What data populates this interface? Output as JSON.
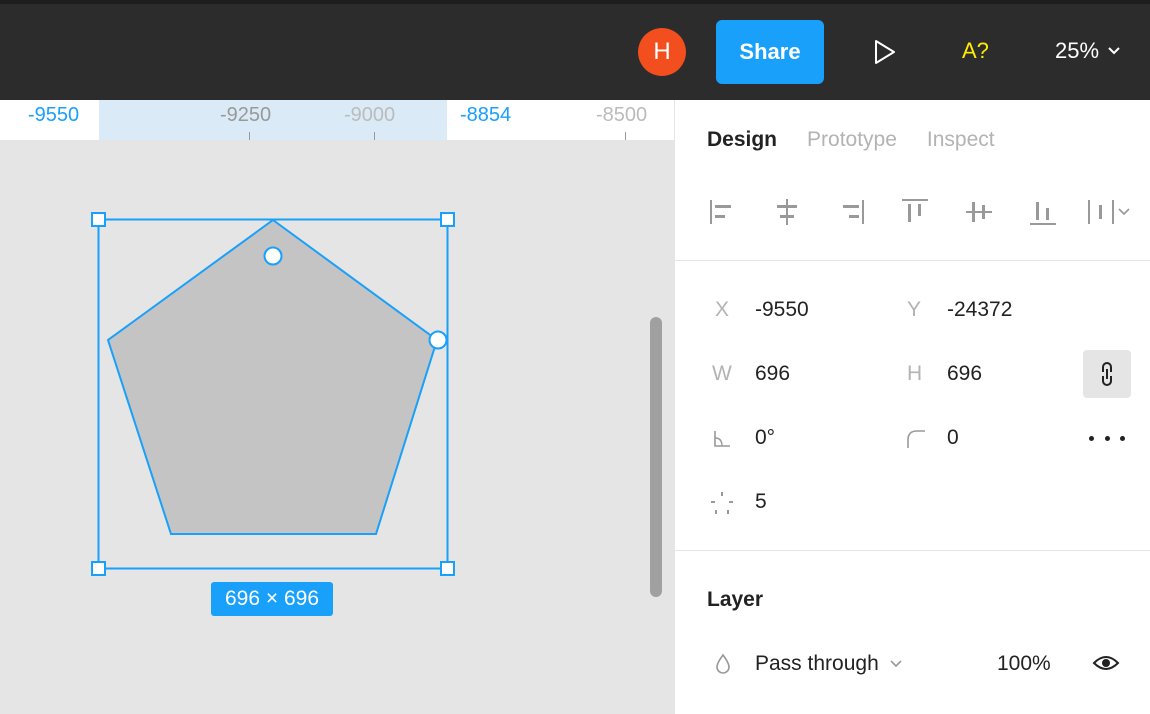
{
  "topbar": {
    "avatar_initial": "H",
    "share_label": "Share",
    "a11y_label": "A?",
    "zoom_label": "25%",
    "colors": {
      "avatar": "#f24e1e",
      "share": "#18a0fb",
      "a11y": "#ffeb00"
    }
  },
  "canvas": {
    "ruler": {
      "left_value": "-9550",
      "mark_1": "-9250",
      "mark_2": "-9000",
      "right_value": "-8854",
      "mark_3": "-8500"
    },
    "size_badge": "696 × 696",
    "selection_color": "#18a0fb",
    "shape_fill": "#c4c4c4"
  },
  "panel": {
    "tabs": [
      {
        "label": "Design",
        "active": true
      },
      {
        "label": "Prototype",
        "active": false
      },
      {
        "label": "Inspect",
        "active": false
      }
    ],
    "align_icons": [
      "align-left-icon",
      "align-horizontal-center-icon",
      "align-right-icon",
      "align-top-icon",
      "align-vertical-center-icon",
      "align-bottom-icon",
      "distribute-icon"
    ],
    "props": {
      "x_label": "X",
      "x_value": "-9550",
      "y_label": "Y",
      "y_value": "-24372",
      "w_label": "W",
      "w_value": "696",
      "h_label": "H",
      "h_value": "696",
      "rotation_value": "0°",
      "radius_value": "0",
      "count_value": "5"
    },
    "layer": {
      "title": "Layer",
      "blend_mode": "Pass through",
      "opacity": "100%"
    }
  }
}
